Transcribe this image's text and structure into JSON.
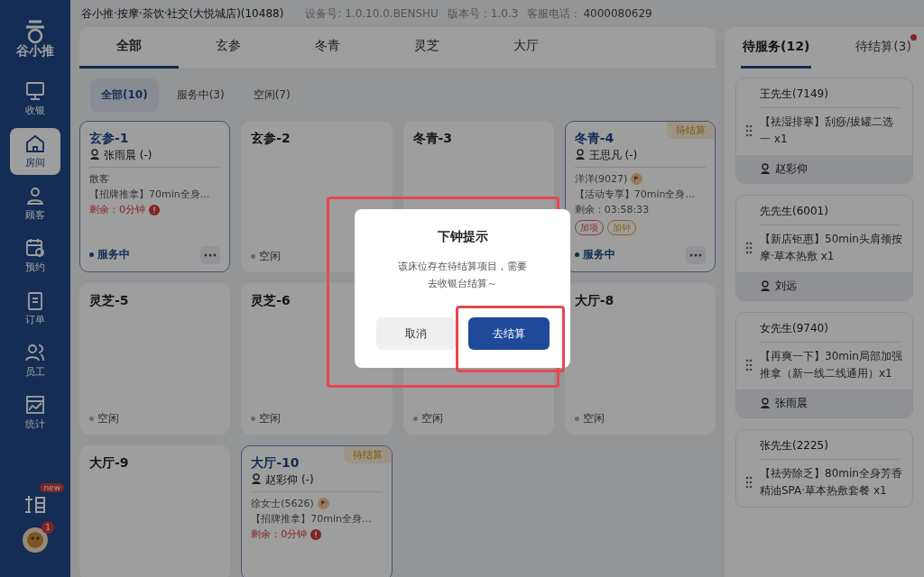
{
  "header": {
    "store": "谷小推·按摩·茶饮·社交(大悦城店)(10488)",
    "device": "设备号: 1.0.10.0.BENSHU",
    "version": "版本号：1.0.3",
    "phone_label": "客服电话：",
    "phone": "4000080629"
  },
  "sidebar": {
    "logo": "谷小推",
    "items": [
      {
        "label": "收银",
        "kind": "monitor",
        "selected": false
      },
      {
        "label": "房间",
        "kind": "house",
        "selected": true
      },
      {
        "label": "顾客",
        "kind": "person",
        "selected": false
      },
      {
        "label": "预约",
        "kind": "calendar",
        "selected": false
      },
      {
        "label": "订单",
        "kind": "clipboard",
        "selected": false
      },
      {
        "label": "员工",
        "kind": "people",
        "selected": false
      },
      {
        "label": "统计",
        "kind": "chart",
        "selected": false
      }
    ],
    "promo_badge": "new",
    "avatar_badge": "1"
  },
  "area_tabs": [
    {
      "label": "全部",
      "selected": true
    },
    {
      "label": "玄参",
      "selected": false
    },
    {
      "label": "冬青",
      "selected": false
    },
    {
      "label": "灵芝",
      "selected": false
    },
    {
      "label": "大厅",
      "selected": false
    }
  ],
  "filters": [
    {
      "label": "全部(10)",
      "selected": true
    },
    {
      "label": "服务中(3)",
      "selected": false
    },
    {
      "label": "空闲(7)",
      "selected": false
    }
  ],
  "rooms": [
    {
      "name": "玄参-1",
      "kind": "serving",
      "status_text": "服务中",
      "staff": "张雨晨 (-)",
      "customer": "散客",
      "service": "【招牌推拿】70min全身...",
      "remaining": "剩余：0分钟",
      "overdue": true,
      "more": true
    },
    {
      "name": "玄参-2",
      "kind": "idle",
      "status_text": "空闲"
    },
    {
      "name": "冬青-3",
      "kind": "idle"
    },
    {
      "name": "冬青-4",
      "kind": "serving",
      "status_text": "服务中",
      "pending": "待结算",
      "staff": "王思凡 (-)",
      "customer": "洋洋(9027)",
      "member": true,
      "service": "【活动专享】70min全身...",
      "remaining": "剩余：03:58:33",
      "overdue": false,
      "tags": [
        {
          "label": "加项",
          "kind": "extra_item"
        },
        {
          "label": "加钟",
          "kind": "extra_time"
        }
      ],
      "more": true
    },
    {
      "name": "灵芝-5",
      "kind": "idle",
      "status_text": "空闲"
    },
    {
      "name": "灵芝-6",
      "kind": "idle",
      "status_text": "空闲"
    },
    {
      "kind": "idle",
      "status_text": "空闲"
    },
    {
      "name": "大厅-8",
      "kind": "idle",
      "status_text": "空闲"
    },
    {
      "name": "大厅-9",
      "kind": "idle"
    },
    {
      "name": "大厅-10",
      "kind": "serving",
      "pending": "待结算",
      "staff": "赵彩仰 (-)",
      "customer": "徐女士(5626)",
      "member": true,
      "service": "【招牌推拿】70min全身...",
      "remaining": "剩余：0分钟",
      "overdue": true
    }
  ],
  "queue_tabs": [
    {
      "label": "待服务(12)",
      "selected": true,
      "dot": false
    },
    {
      "label": "待结算(3)",
      "selected": false,
      "dot": true
    }
  ],
  "queue": [
    {
      "customer": "王先生(7149)",
      "service": "【祛湿排寒】刮痧/拔罐二选一 x1",
      "staff": "赵彩仰"
    },
    {
      "customer": "先先生(6001)",
      "service": "【新店钜惠】50min头肩颈按摩·草本热敷 x1",
      "staff": "刘远"
    },
    {
      "customer": "女先生(9740)",
      "service": "【再爽一下】30min局部加强推拿（新一线二线通用）x1",
      "staff": "张雨晨"
    },
    {
      "customer": "张先生(2225)",
      "service": "【祛劳除乏】80min全身芳香精油SPA·草本热敷套餐 x1"
    }
  ],
  "dialog": {
    "title": "下钟提示",
    "message": "该床位存在待结算项目，需要去收银台结算～",
    "cancel": "取消",
    "confirm": "去结算"
  }
}
